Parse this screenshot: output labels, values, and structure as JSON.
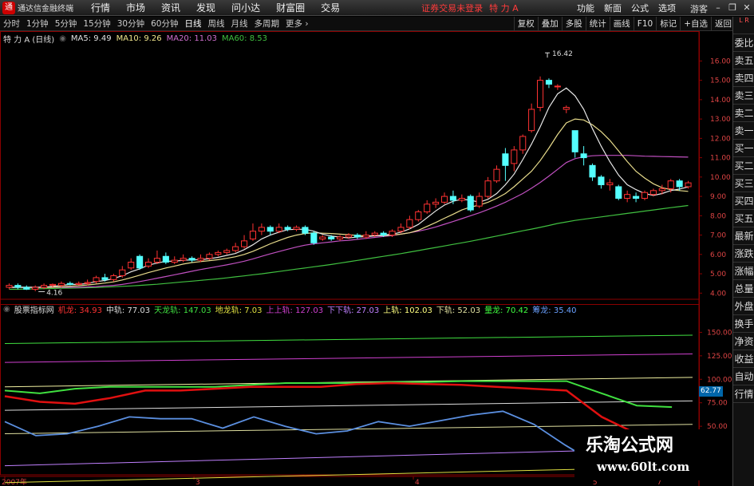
{
  "window": {
    "app_name": "通达信金融终端",
    "menu": [
      "行情",
      "市场",
      "资讯",
      "发现",
      "问小达",
      "财富圈",
      "交易"
    ],
    "notice": "证券交易未登录",
    "stock_title": "特 力 A",
    "right_menu": [
      "功能",
      "新面",
      "公式",
      "选项"
    ],
    "guest": "游客",
    "controls": [
      "–",
      "❐",
      "✕"
    ]
  },
  "period_bar": {
    "items": [
      "分时",
      "1分钟",
      "5分钟",
      "15分钟",
      "30分钟",
      "60分钟",
      "日线",
      "周线",
      "月线",
      "多周期",
      "更多 ›"
    ],
    "active": "日线",
    "tools": [
      "复权",
      "叠加",
      "多股",
      "统计",
      "画线",
      "F10",
      "标记",
      "+自选",
      "返回"
    ]
  },
  "main_chart": {
    "title": "特 力 A (日线)",
    "ma": [
      {
        "label": "MA5: 9.49",
        "color": "#e0e0e0"
      },
      {
        "label": "MA10: 9.26",
        "color": "#f0e68c"
      },
      {
        "label": "MA20: 11.03",
        "color": "#d070d0"
      },
      {
        "label": "MA60: 8.53",
        "color": "#40c040"
      }
    ],
    "y_ticks": [
      "16.00",
      "15.00",
      "14.00",
      "13.00",
      "12.00",
      "11.00",
      "10.00",
      "9.00",
      "8.00",
      "7.00",
      "6.00",
      "5.00",
      "4.00"
    ],
    "high_label": "16.42",
    "low_label": "4.16"
  },
  "indicator": {
    "name": "股票指标网",
    "items": [
      {
        "label": "机龙:",
        "value": "34.93",
        "color": "#ff3333"
      },
      {
        "label": "中轨:",
        "value": "77.03",
        "color": "#dddddd"
      },
      {
        "label": "天龙轨:",
        "value": "147.03",
        "color": "#40e040"
      },
      {
        "label": "地龙轨:",
        "value": "7.03",
        "color": "#e0e040"
      },
      {
        "label": "上上轨:",
        "value": "127.03",
        "color": "#d040d0"
      },
      {
        "label": "下下轨:",
        "value": "27.03",
        "color": "#c080ff"
      },
      {
        "label": "上轨:",
        "value": "102.03",
        "color": "#ffff80"
      },
      {
        "label": "下轨:",
        "value": "52.03",
        "color": "#e0e0a0"
      },
      {
        "label": "量龙:",
        "value": "70.42",
        "color": "#40ff40"
      },
      {
        "label": "筹龙:",
        "value": "35.40",
        "color": "#6aa0ff"
      }
    ],
    "y_ticks": [
      "150.00",
      "125.00",
      "100.00",
      "75.00",
      "50.00"
    ],
    "cursor_value": "62.77"
  },
  "x_axis": {
    "labels": [
      "2007年",
      "3",
      "4",
      "5",
      "7"
    ]
  },
  "side_panel": {
    "top": "L\nR",
    "items": [
      "委比",
      "卖五",
      "卖四",
      "卖三",
      "卖二",
      "卖一",
      "买一",
      "买二",
      "买三",
      "买四",
      "买五",
      "最新",
      "涨跌",
      "涨幅",
      "总量",
      "外盘",
      "换手",
      "净资",
      "收益",
      "自动",
      "行情"
    ]
  },
  "watermark": {
    "line1": "乐淘公式网",
    "line2": "www.60lt.com"
  },
  "chart_data": {
    "type": "candlestick",
    "ylim": [
      3.6,
      16.8
    ],
    "candles": [
      [
        4.3,
        4.4,
        4.2,
        4.5
      ],
      [
        4.4,
        4.3,
        4.2,
        4.5
      ],
      [
        4.3,
        4.2,
        4.16,
        4.4
      ],
      [
        4.2,
        4.3,
        4.1,
        4.4
      ],
      [
        4.3,
        4.4,
        4.2,
        4.5
      ],
      [
        4.4,
        4.45,
        4.3,
        4.5
      ],
      [
        4.4,
        4.5,
        4.3,
        4.6
      ],
      [
        4.5,
        4.45,
        4.4,
        4.6
      ],
      [
        4.45,
        4.5,
        4.4,
        4.6
      ],
      [
        4.5,
        4.55,
        4.4,
        4.7
      ],
      [
        4.6,
        4.8,
        4.5,
        4.9
      ],
      [
        4.8,
        4.7,
        4.6,
        5.0
      ],
      [
        4.7,
        4.9,
        4.6,
        5.0
      ],
      [
        4.9,
        5.2,
        4.8,
        5.4
      ],
      [
        5.3,
        5.6,
        5.2,
        5.8
      ],
      [
        5.9,
        5.3,
        5.2,
        6.0
      ],
      [
        5.4,
        5.6,
        5.3,
        5.8
      ],
      [
        5.6,
        5.8,
        5.5,
        6.2
      ],
      [
        5.9,
        5.6,
        5.5,
        6.1
      ],
      [
        5.6,
        5.7,
        5.5,
        5.9
      ],
      [
        5.7,
        5.8,
        5.6,
        6.0
      ],
      [
        5.8,
        5.7,
        5.6,
        5.9
      ],
      [
        5.7,
        5.8,
        5.6,
        6.0
      ],
      [
        5.8,
        6.0,
        5.7,
        6.1
      ],
      [
        6.0,
        6.1,
        5.9,
        6.2
      ],
      [
        6.1,
        6.2,
        6.0,
        6.3
      ],
      [
        6.2,
        6.4,
        6.1,
        6.6
      ],
      [
        6.4,
        6.7,
        6.3,
        7.0
      ],
      [
        6.8,
        7.2,
        6.7,
        7.6
      ],
      [
        7.2,
        7.4,
        7.0,
        7.6
      ],
      [
        7.4,
        7.2,
        7.0,
        7.5
      ],
      [
        7.2,
        7.4,
        7.1,
        7.6
      ],
      [
        7.4,
        7.3,
        7.2,
        7.5
      ],
      [
        7.3,
        7.4,
        7.2,
        7.5
      ],
      [
        7.4,
        7.1,
        7.0,
        7.5
      ],
      [
        7.1,
        6.6,
        6.5,
        7.2
      ],
      [
        6.8,
        6.9,
        6.7,
        7.0
      ],
      [
        6.9,
        6.8,
        6.7,
        7.0
      ],
      [
        6.8,
        6.9,
        6.7,
        7.0
      ],
      [
        6.9,
        7.0,
        6.8,
        7.1
      ],
      [
        7.0,
        6.9,
        6.8,
        7.1
      ],
      [
        6.9,
        7.0,
        6.8,
        7.2
      ],
      [
        7.0,
        7.1,
        6.9,
        7.2
      ],
      [
        7.1,
        7.0,
        6.9,
        7.2
      ],
      [
        7.0,
        7.2,
        6.9,
        7.3
      ],
      [
        7.2,
        7.4,
        7.1,
        7.6
      ],
      [
        7.4,
        7.8,
        7.3,
        8.0
      ],
      [
        7.8,
        8.2,
        7.7,
        8.3
      ],
      [
        8.2,
        8.6,
        8.1,
        8.8
      ],
      [
        8.6,
        8.7,
        8.4,
        8.9
      ],
      [
        8.7,
        9.0,
        8.6,
        9.2
      ],
      [
        9.0,
        8.8,
        8.6,
        9.3
      ],
      [
        8.8,
        8.9,
        8.7,
        9.1
      ],
      [
        9.0,
        8.3,
        8.2,
        9.1
      ],
      [
        8.5,
        9.0,
        8.4,
        9.2
      ],
      [
        9.0,
        9.8,
        8.9,
        10.0
      ],
      [
        9.8,
        10.4,
        9.7,
        10.6
      ],
      [
        11.2,
        10.6,
        9.8,
        11.5
      ],
      [
        10.7,
        11.4,
        10.3,
        11.6
      ],
      [
        11.4,
        12.1,
        11.2,
        12.2
      ],
      [
        12.4,
        13.5,
        12.3,
        13.8
      ],
      [
        13.6,
        15.0,
        13.4,
        15.2
      ],
      [
        15.0,
        14.8,
        14.6,
        15.1
      ],
      [
        14.7,
        14.7,
        14.5,
        14.8
      ],
      [
        13.5,
        13.6,
        13.3,
        13.7
      ],
      [
        12.4,
        11.3,
        11.0,
        12.4
      ],
      [
        11.2,
        11.0,
        10.6,
        11.6
      ],
      [
        10.6,
        10.0,
        9.8,
        10.7
      ],
      [
        10.0,
        9.6,
        9.4,
        10.1
      ],
      [
        9.6,
        9.7,
        9.3,
        9.9
      ],
      [
        9.5,
        8.9,
        8.8,
        9.6
      ],
      [
        8.9,
        9.1,
        8.7,
        9.3
      ],
      [
        9.0,
        8.9,
        8.7,
        9.2
      ],
      [
        8.9,
        9.2,
        8.8,
        9.3
      ],
      [
        9.1,
        9.3,
        9.0,
        9.4
      ],
      [
        9.3,
        9.4,
        9.1,
        9.6
      ],
      [
        9.4,
        9.8,
        9.2,
        9.9
      ],
      [
        9.8,
        9.5,
        9.3,
        9.9
      ],
      [
        9.5,
        9.7,
        9.4,
        9.8
      ]
    ],
    "ma5": [
      4.3,
      4.3,
      4.3,
      4.3,
      4.3,
      4.35,
      4.4,
      4.45,
      4.45,
      4.5,
      4.6,
      4.65,
      4.75,
      4.9,
      5.1,
      5.25,
      5.45,
      5.55,
      5.65,
      5.65,
      5.7,
      5.72,
      5.73,
      5.78,
      5.85,
      5.95,
      6.05,
      6.25,
      6.5,
      6.8,
      7.0,
      7.15,
      7.28,
      7.3,
      7.3,
      7.2,
      7.05,
      6.95,
      6.9,
      6.85,
      6.9,
      6.92,
      6.96,
      7.0,
      7.05,
      7.15,
      7.32,
      7.55,
      7.9,
      8.25,
      8.55,
      8.75,
      8.85,
      8.8,
      8.7,
      8.85,
      9.15,
      9.6,
      10.15,
      10.9,
      11.7,
      12.6,
      13.6,
      14.3,
      14.6,
      14.2,
      13.5,
      12.5,
      11.6,
      10.8,
      10.1,
      9.6,
      9.35,
      9.15,
      9.05,
      9.15,
      9.3,
      9.38,
      9.49
    ],
    "ma10": [
      4.3,
      4.3,
      4.3,
      4.3,
      4.3,
      4.3,
      4.33,
      4.36,
      4.38,
      4.42,
      4.47,
      4.52,
      4.58,
      4.68,
      4.8,
      4.93,
      5.06,
      5.18,
      5.3,
      5.4,
      5.5,
      5.58,
      5.63,
      5.68,
      5.73,
      5.8,
      5.88,
      6.0,
      6.16,
      6.35,
      6.55,
      6.72,
      6.88,
      7.0,
      7.08,
      7.12,
      7.1,
      7.08,
      7.05,
      7.02,
      6.98,
      6.96,
      6.96,
      6.97,
      7.0,
      7.05,
      7.12,
      7.25,
      7.45,
      7.65,
      7.87,
      8.08,
      8.3,
      8.45,
      8.55,
      8.7,
      8.9,
      9.15,
      9.5,
      9.9,
      10.3,
      10.85,
      11.5,
      12.2,
      12.8,
      13.0,
      12.95,
      12.7,
      12.35,
      11.9,
      11.35,
      10.8,
      10.3,
      9.95,
      9.65,
      9.45,
      9.35,
      9.3,
      9.26
    ],
    "ma20": [
      4.3,
      4.3,
      4.3,
      4.3,
      4.3,
      4.3,
      4.3,
      4.3,
      4.3,
      4.32,
      4.34,
      4.37,
      4.4,
      4.45,
      4.52,
      4.6,
      4.68,
      4.77,
      4.86,
      4.95,
      5.04,
      5.13,
      5.22,
      5.3,
      5.38,
      5.46,
      5.55,
      5.65,
      5.77,
      5.9,
      6.03,
      6.15,
      6.27,
      6.38,
      6.48,
      6.55,
      6.6,
      6.65,
      6.7,
      6.73,
      6.78,
      6.83,
      6.88,
      6.93,
      6.98,
      7.05,
      7.12,
      7.2,
      7.3,
      7.42,
      7.56,
      7.7,
      7.85,
      8.0,
      8.15,
      8.32,
      8.5,
      8.7,
      8.92,
      9.15,
      9.42,
      9.72,
      10.05,
      10.4,
      10.75,
      10.95,
      11.05,
      11.1,
      11.12,
      11.12,
      11.12,
      11.12,
      11.1,
      11.08,
      11.07,
      11.06,
      11.05,
      11.04,
      11.03
    ],
    "ma60": [
      4.2,
      4.2,
      4.21,
      4.22,
      4.23,
      4.24,
      4.25,
      4.26,
      4.27,
      4.28,
      4.29,
      4.31,
      4.33,
      4.35,
      4.37,
      4.4,
      4.43,
      4.46,
      4.5,
      4.54,
      4.58,
      4.62,
      4.66,
      4.7,
      4.74,
      4.79,
      4.84,
      4.89,
      4.95,
      5.0,
      5.06,
      5.12,
      5.18,
      5.24,
      5.3,
      5.36,
      5.42,
      5.48,
      5.55,
      5.62,
      5.69,
      5.76,
      5.83,
      5.9,
      5.97,
      6.04,
      6.12,
      6.2,
      6.28,
      6.36,
      6.44,
      6.52,
      6.6,
      6.68,
      6.77,
      6.86,
      6.95,
      7.04,
      7.13,
      7.22,
      7.31,
      7.4,
      7.5,
      7.6,
      7.68,
      7.76,
      7.82,
      7.88,
      7.94,
      8.0,
      8.06,
      8.12,
      8.18,
      8.24,
      8.3,
      8.36,
      8.42,
      8.47,
      8.53
    ],
    "ind_ylim": [
      0,
      175
    ],
    "ind_x": [
      0,
      10,
      20,
      30,
      40,
      50,
      60,
      70,
      78
    ],
    "jilong": [
      82,
      76,
      74,
      80,
      88,
      88,
      90,
      92,
      92,
      92,
      95,
      96,
      95,
      94,
      92,
      90,
      88,
      60,
      42,
      34.93
    ],
    "chulong": [
      55,
      40,
      42,
      50,
      60,
      58,
      58,
      48,
      60,
      50,
      42,
      45,
      55,
      50,
      56,
      62,
      66,
      52,
      30,
      10
    ],
    "lianglong": [
      88,
      85,
      90,
      92,
      92,
      92,
      92,
      94,
      96,
      96,
      96,
      97,
      97,
      98,
      98,
      98,
      98,
      85,
      72,
      70.42
    ],
    "ind_lines": [
      {
        "name": "天龙轨",
        "color": "#40e040",
        "start": 138,
        "end": 147
      },
      {
        "name": "上上轨",
        "color": "#d040d0",
        "start": 118,
        "end": 127
      },
      {
        "name": "上轨",
        "color": "#f0f0a0",
        "start": 92,
        "end": 102
      },
      {
        "name": "中轨",
        "color": "#dddddd",
        "start": 67,
        "end": 77
      },
      {
        "name": "下轨",
        "color": "#e0e0a0",
        "start": 42,
        "end": 52
      },
      {
        "name": "下下轨",
        "color": "#c080ff",
        "start": 8,
        "end": 27
      },
      {
        "name": "地龙轨",
        "color": "#e0e040",
        "start": -10,
        "end": 7
      }
    ]
  }
}
